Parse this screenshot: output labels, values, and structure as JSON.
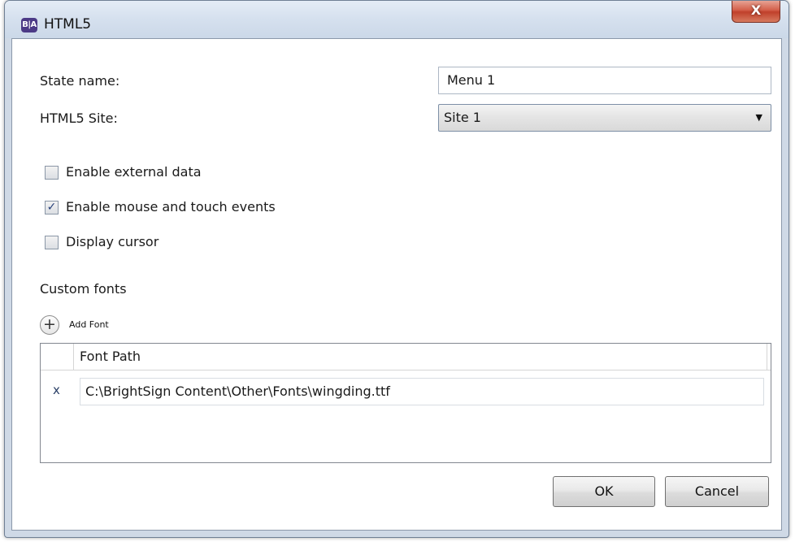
{
  "window": {
    "app_logo_text": "B|A",
    "title": "HTML5",
    "close_label": "X"
  },
  "form": {
    "state_name_label": "State name:",
    "state_name_value": "Menu 1",
    "site_label": "HTML5 Site:",
    "site_selected": "Site 1"
  },
  "options": [
    {
      "label": "Enable external data",
      "checked": false
    },
    {
      "label": "Enable mouse and touch events",
      "checked": true
    },
    {
      "label": "Display cursor",
      "checked": false
    }
  ],
  "custom_fonts": {
    "heading": "Custom fonts",
    "add_button_label": "Add Font",
    "column_header": "Font Path",
    "rows": [
      {
        "remove_label": "x",
        "path": "C:\\BrightSign Content\\Other\\Fonts\\wingding.ttf"
      }
    ]
  },
  "buttons": {
    "ok_label": "OK",
    "cancel_label": "Cancel"
  },
  "icons": {
    "app": "app-logo-icon",
    "close": "close-icon",
    "dropdown_arrow": "chevron-down-icon",
    "add": "plus-circle-icon",
    "check": "checkmark-icon"
  }
}
